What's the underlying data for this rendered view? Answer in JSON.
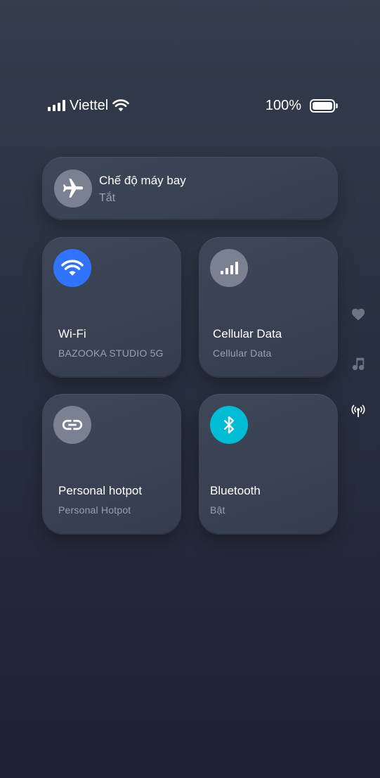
{
  "status_bar": {
    "carrier": "Viettel",
    "battery_percent": "100%",
    "signal_icon": "cellular-signal-icon",
    "wifi_icon": "wifi-icon",
    "battery_icon": "battery-full-icon"
  },
  "airplane_mode": {
    "title": "Chế độ máy bay",
    "status": "Tắt",
    "icon": "airplane-icon"
  },
  "tiles": {
    "wifi": {
      "title": "Wi-Fi",
      "subtitle": "BAZOOKA STUDIO 5G",
      "icon": "wifi-icon",
      "color": "#2f73ff"
    },
    "cellular": {
      "title": "Cellular Data",
      "subtitle": "Cellular Data",
      "icon": "cellular-signal-icon",
      "color": "#7a8190"
    },
    "hotspot": {
      "title": "Personal hotpot",
      "subtitle": "Personal Hotpot",
      "icon": "link-icon",
      "color": "#7a8190"
    },
    "bluetooth": {
      "title": "Bluetooth",
      "subtitle": "Bật",
      "icon": "bluetooth-icon",
      "color": "#00bcd4"
    }
  },
  "side_nav": {
    "items": [
      "heart-icon",
      "music-note-icon",
      "antenna-broadcast-icon"
    ]
  }
}
